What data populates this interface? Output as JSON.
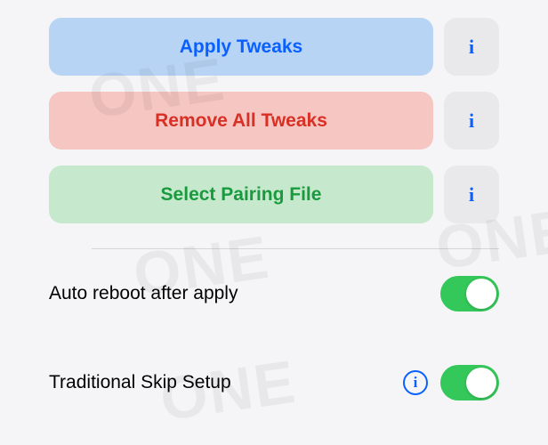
{
  "buttons": {
    "apply": {
      "label": "Apply Tweaks",
      "info": "i"
    },
    "remove": {
      "label": "Remove All Tweaks",
      "info": "i"
    },
    "select": {
      "label": "Select Pairing File",
      "info": "i"
    }
  },
  "settings": {
    "auto_reboot": {
      "label": "Auto reboot after apply",
      "enabled": true
    },
    "skip_setup": {
      "label": "Traditional Skip Setup",
      "enabled": true,
      "has_info": true,
      "info": "i"
    }
  },
  "watermark": "ONE"
}
